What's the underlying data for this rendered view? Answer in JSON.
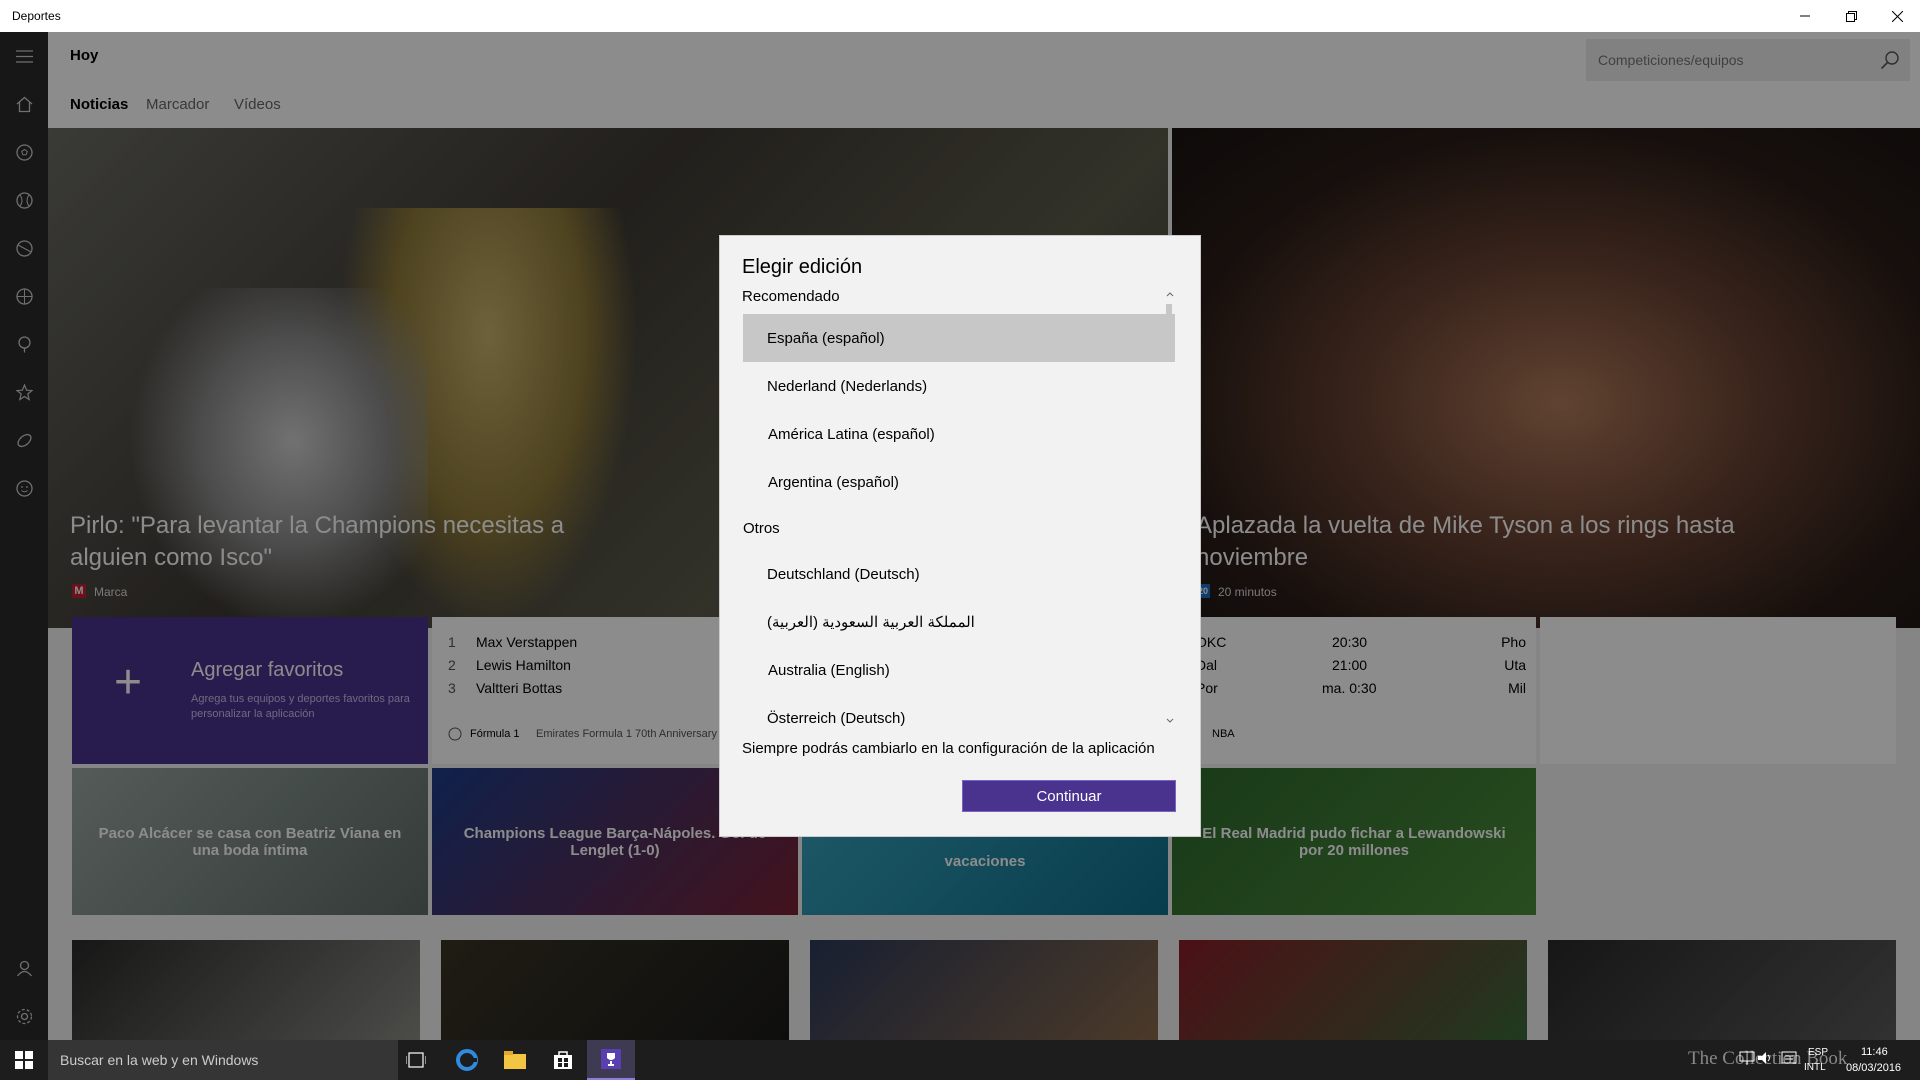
{
  "window": {
    "title": "Deportes",
    "minimize": "—",
    "maximize": "❐",
    "close": "✕"
  },
  "header": {
    "title": "Hoy",
    "tabs": [
      {
        "label": "Noticias",
        "active": true
      },
      {
        "label": "Marcador"
      },
      {
        "label": "Vídeos"
      }
    ],
    "search_placeholder": "Competiciones/equipos"
  },
  "sidebar": {
    "icons": [
      "menu-icon",
      "home-icon",
      "soccer-icon",
      "baseball-icon",
      "tennis-icon",
      "basketball-icon",
      "golf-icon",
      "motorsport-icon",
      "rugby-icon",
      "more-sports-icon",
      "account-icon",
      "settings-icon"
    ]
  },
  "hero": [
    {
      "title": "Pirlo: \"Para levantar la Champions necesitas a alguien como Isco\"",
      "source": "Marca",
      "source_badge": "M"
    },
    {
      "title": "Aplazada la vuelta de Mike Tyson a los rings hasta noviembre",
      "source": "20 minutos",
      "source_badge": "20"
    }
  ],
  "favorites": {
    "title": "Agregar favoritos",
    "subtitle": "Agrega tus equipos y deportes favoritos para personalizar la aplicación",
    "plus": "+"
  },
  "f1": {
    "standings": [
      {
        "pos": "1",
        "name": "Max Verstappen"
      },
      {
        "pos": "2",
        "name": "Lewis Hamilton"
      },
      {
        "pos": "3",
        "name": "Valtteri Bottas"
      }
    ],
    "league": "Fórmula 1",
    "event": "Emirates Formula 1 70th Anniversary"
  },
  "nba": {
    "games": [
      {
        "away": "OKC",
        "time": "20:30",
        "home": "Pho"
      },
      {
        "away": "Dal",
        "time": "21:00",
        "home": "Uta"
      },
      {
        "away": "Por",
        "time": "ma. 0:30",
        "home": "Mil"
      }
    ],
    "league": "NBA"
  },
  "news_tiles": [
    {
      "caption": "Paco Alcácer se casa con Beatriz Viana en una boda íntima"
    },
    {
      "caption": "Champions League Barça-Nápoles. Gol de Lenglet (1-0)"
    },
    {
      "caption": "vacaciones"
    },
    {
      "caption": "El Real Madrid pudo fichar a Lewandowski por 20 millones"
    }
  ],
  "dialog": {
    "title": "Elegir edición",
    "recommended_label": "Recomendado",
    "recommended": [
      "España (español)",
      "Nederland (Nederlands)",
      "América Latina (español)",
      "Argentina (español)"
    ],
    "others_label": "Otros",
    "others": [
      "Deutschland (Deutsch)",
      "المملكة العربية السعودية (العربية)",
      "Australia (English)",
      "Österreich (Deutsch)"
    ],
    "selected": "España (español)",
    "note": "Siempre podrás cambiarlo en la configuración de la aplicación",
    "continue_label": "Continuar"
  },
  "taskbar": {
    "search_placeholder": "Buscar en la web y en Windows",
    "lang": "ESP",
    "layout": "INTL",
    "time": "11:46",
    "date": "08/03/2016",
    "watermark": "The Collection Book"
  },
  "colors": {
    "accent": "#49338f",
    "sidebar": "#2b2b2b",
    "taskbar": "#1d1d1d"
  }
}
